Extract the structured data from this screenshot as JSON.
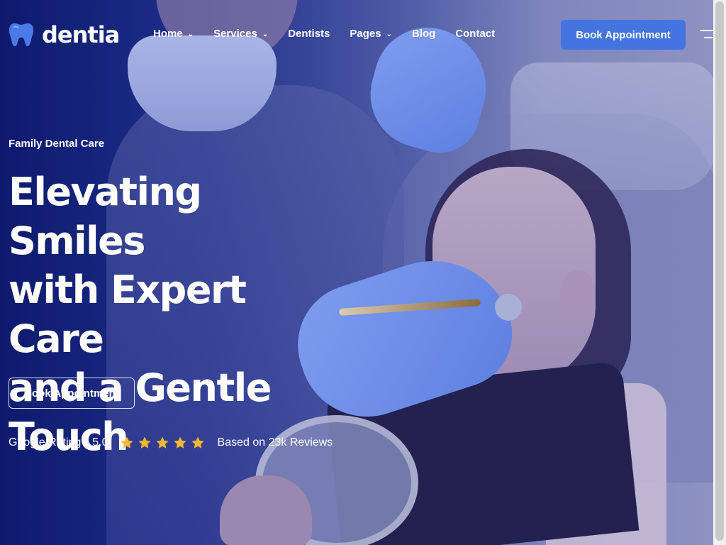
{
  "brand": {
    "name": "dentia",
    "logo_icon": "tooth-icon"
  },
  "nav": {
    "items": [
      {
        "label": "Home",
        "dropdown": true
      },
      {
        "label": "Services",
        "dropdown": true
      },
      {
        "label": "Dentists",
        "dropdown": false
      },
      {
        "label": "Pages",
        "dropdown": true
      },
      {
        "label": "Blog",
        "dropdown": false
      },
      {
        "label": "Contact",
        "dropdown": false
      }
    ],
    "cta_label": "Book Appointment",
    "menu_icon": "hamburger-icon"
  },
  "hero": {
    "eyebrow": "Family Dental Care",
    "headline_lines": [
      "Elevating Smiles",
      "with Expert Care",
      "and a Gentle",
      "Touch"
    ],
    "cta_label": "Book Appointment",
    "rating": {
      "label": "Google Rating",
      "score": "5.0",
      "stars": 5,
      "reviews_text": "Based on 23k Reviews"
    }
  },
  "colors": {
    "overlay_dark": "#0d1a6e",
    "accent": "#4474e0",
    "star": "#f5b82e",
    "text": "#ffffff"
  }
}
